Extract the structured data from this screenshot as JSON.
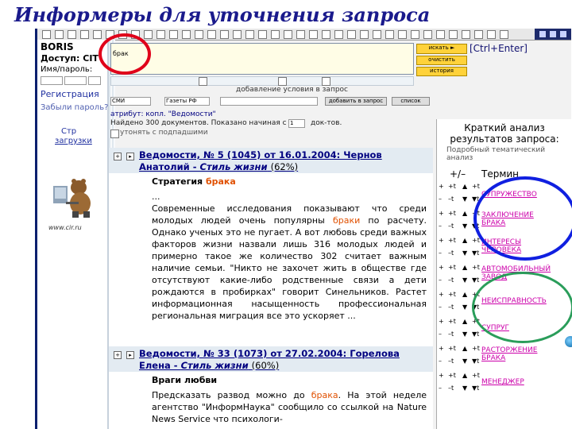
{
  "page_title": "Информеры для уточнения запроса",
  "left_panel": {
    "user": "BORIS",
    "access": "Доступ: CIT",
    "login_label": "Имя/пароль:",
    "register_link": "Регистрация",
    "forgot_link": "Забыли пароль?",
    "help_link_1": "Стр",
    "help_link_2": "загрузки",
    "logo_text": "www.cir.ru"
  },
  "search": {
    "query": "брак",
    "search_button": "искать ►",
    "clear_button": "очистить",
    "history_button": "история",
    "shortcut": "[Ctrl+Enter]",
    "add_condition": "добавление условия в запрос",
    "attribute_label": "атрибут: копл. \"Ведомости\"",
    "found_text": "Найдено 300 документов. Показано начиная с №",
    "page_value": "1",
    "docs_label": "док-тов.",
    "refine_label": "утонять с подпадшими",
    "add_button": "добавить в запрос",
    "apply_button": "список",
    "select_1": "СМИ",
    "select_2": "Газеты РФ"
  },
  "results": [
    {
      "title": "Ведомости, № 5 (1045) от 16.01.2004: Чернов Анатолий - ",
      "rubric": "Стиль жизни",
      "relevance": "(62%)",
      "heading_prefix": "Стратегия ",
      "heading_hl": "брака",
      "ellipsis": "...",
      "text_1": "Современные исследования показывают что среди молодых людей очень популярны ",
      "text_hl": "браки",
      "text_2": " по расчету. Однако ученых это не пугает. А вот любовь среди важных факторов жизни назвали лишь 316 молодых людей и примерно такое же количество 302 считает важным наличие семьи. \"Никто не захочет жить в обществе где отсутствуют какие-либо родственные связи а дети рождаются в пробирках\" говорит Синельников. Растет информационная насыщенность профессиональная региональная миграция все это ускоряет ..."
    },
    {
      "title": "Ведомости, № 33 (1073) от 27.02.2004: Горелова Елена - ",
      "rubric": "Стиль жизни",
      "relevance": "(60%)",
      "heading_prefix": "Враги любви",
      "heading_hl": "",
      "text_1": "Предсказать развод можно до ",
      "text_hl": "брака",
      "text_2": ". На этой неделе агентство \"ИнформНаука\" сообщило со ссылкой на Nature News Service что психологи-"
    }
  ],
  "analysis": {
    "title_line1": "Краткий анализ",
    "title_line2": "результатов запроса:",
    "subtitle_line1": "Подробный тематический",
    "subtitle_line2": "анализ",
    "col_plusminus": "+/–",
    "col_term": "Термин",
    "terms": [
      "СУПРУЖЕСТВО",
      "ЗАКЛЮЧЕНИЕ БРАКА",
      "ИНТЕРЕСЫ ЧЕЛОВЕКА",
      "АВТОМОБИЛЬНЫЙ ЗАВОД",
      "НЕИСПРАВНОСТЬ",
      "СУПРУГ",
      "РАСТОРЖЕНИЕ БРАКА",
      "МЕНЕДЖЕР"
    ],
    "plus_label": "+",
    "plus_t": "+t",
    "minus_label": "–",
    "minus_t": "–t",
    "up_label": "▲",
    "down_label": "▼",
    "up_t": "+t",
    "down_t": "▼t"
  },
  "colors": {
    "title": "#1a1a8c",
    "highlight": "#e05000",
    "term": "#cc00aa",
    "link": "#000080"
  }
}
